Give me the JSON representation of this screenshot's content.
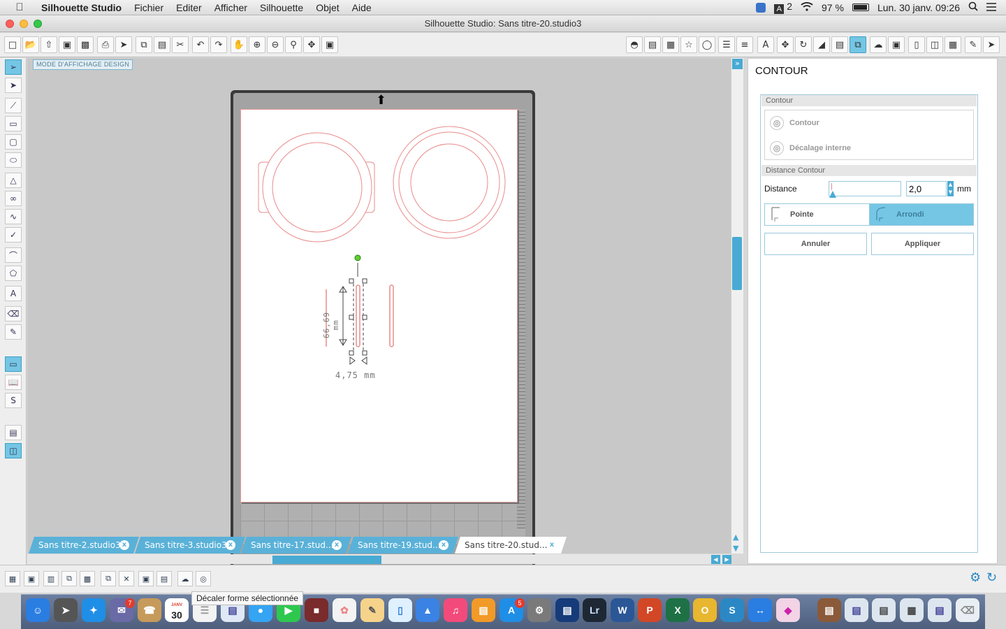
{
  "menubar": {
    "apple": "",
    "app_name": "Silhouette Studio",
    "items": [
      "Fichier",
      "Editer",
      "Afficher",
      "Silhouette",
      "Objet",
      "Aide"
    ],
    "status": {
      "input_source": "2",
      "battery": "97 %",
      "datetime": "Lun. 30 janv.  09:26"
    }
  },
  "window": {
    "title": "Silhouette Studio: Sans titre-20.studio3"
  },
  "canvas": {
    "mode_badge": "MODE D'AFFICHAGE DESIGN",
    "height_dimension": "66,69 mm",
    "width_dimension": "4,75 mm"
  },
  "tabs": [
    {
      "label": "Sans titre-2.studio3",
      "active": false
    },
    {
      "label": "Sans titre-3.studio3",
      "active": false
    },
    {
      "label": "Sans titre-17.stud...",
      "active": false
    },
    {
      "label": "Sans titre-19.stud...",
      "active": false
    },
    {
      "label": "Sans titre-20.stud...",
      "active": true
    }
  ],
  "tab_close": "x",
  "panel": {
    "title": "CONTOUR",
    "section_contour": "Contour",
    "option_contour": "Contour",
    "option_inner": "Décalage interne",
    "section_distance": "Distance Contour",
    "distance_label": "Distance",
    "distance_value": "2,0",
    "distance_unit": "mm",
    "distance_slider_level": 0.02,
    "corner_point": "Pointe",
    "corner_round": "Arrondi",
    "corner_selected": "Arrondi",
    "cancel": "Annuler",
    "apply": "Appliquer"
  },
  "tooltip": "Décaler forme sélectionnée",
  "dock": {
    "calendar_month": "JANV",
    "calendar_day": "30",
    "badge_photos": "7",
    "badge_appstore": "5",
    "lightroom": "Lr"
  },
  "colors": {
    "accent": "#74c6e4",
    "tab_blue": "#5ab1d8",
    "cut_line": "#e98b8b",
    "rotation_handle": "#5fd12c"
  }
}
